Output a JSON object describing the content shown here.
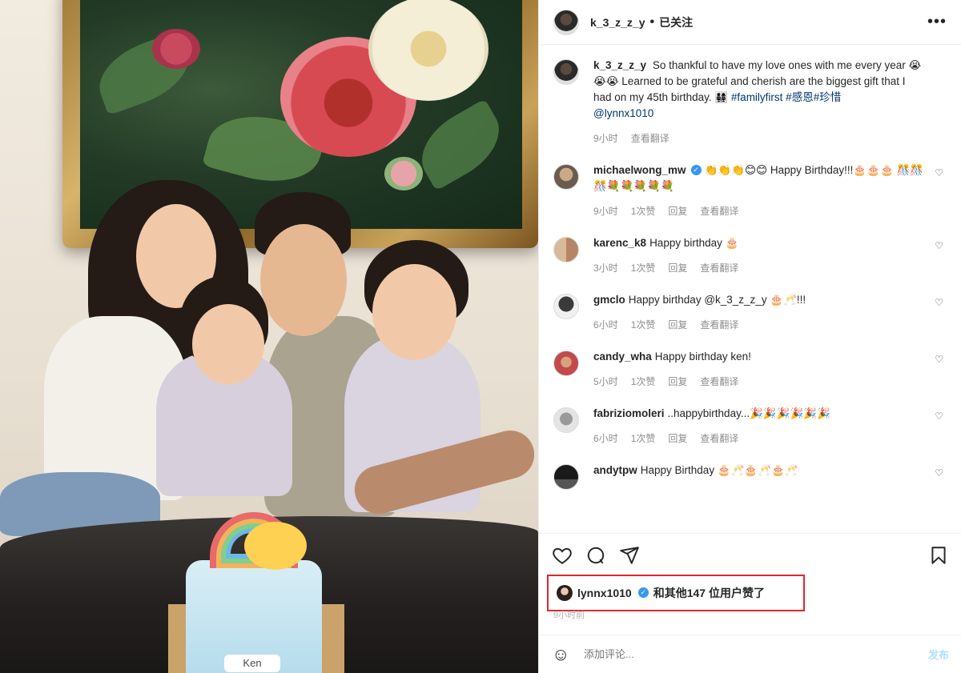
{
  "post": {
    "username": "k_3_z_z_y",
    "separator": "•",
    "follow_status": "已关注",
    "more_icon": "more-icon",
    "caption": {
      "username": "k_3_z_z_y",
      "text": "So thankful to have my love ones with me every year 😭😭😭 Learned to be grateful and cherish are the biggest gift that I had on my 45th birthday. 👨‍👩‍👧‍👧",
      "hashtags": "#familyfirst #感恩#珍惜",
      "mention": "@lynnx1010",
      "time": "9小时",
      "translate": "查看翻译"
    },
    "photo": {
      "cake_name": "Ken"
    }
  },
  "comments": [
    {
      "username": "michaelwong_mw",
      "verified": true,
      "text": "👏👏👏😊😊 Happy Birthday!!!🎂🎂🎂 🎊🎊🎊💐💐💐💐💐",
      "time": "9小时",
      "likes": "1次赞",
      "reply": "回复",
      "translate": "查看翻译"
    },
    {
      "username": "karenc_k8",
      "verified": false,
      "text": "Happy birthday 🎂",
      "time": "3小时",
      "likes": "1次赞",
      "reply": "回复",
      "translate": "查看翻译"
    },
    {
      "username": "gmclo",
      "verified": false,
      "text": "Happy birthday @k_3_z_z_y 🎂🥂!!!",
      "time": "6小时",
      "likes": "1次赞",
      "reply": "回复",
      "translate": "查看翻译"
    },
    {
      "username": "candy_wha",
      "verified": false,
      "text": "Happy birthday ken!",
      "time": "5小时",
      "likes": "1次赞",
      "reply": "回复",
      "translate": "查看翻译"
    },
    {
      "username": "fabriziomoleri",
      "verified": false,
      "text": "..happybirthday...🎉🎉🎉🎉🎉🎉",
      "time": "6小时",
      "likes": "1次赞",
      "reply": "回复",
      "translate": "查看翻译"
    },
    {
      "username": "andytpw",
      "verified": false,
      "text": "Happy Birthday 🎂🥂🎂🥂🎂🥂",
      "time": "",
      "likes": "",
      "reply": "",
      "translate": ""
    }
  ],
  "likes": {
    "first_user": "lynnx1010",
    "rest": "和其他147 位用户赞了",
    "ago": "9小时前"
  },
  "composer": {
    "placeholder": "添加评论...",
    "post_label": "发布"
  },
  "colors": {
    "accent": "#3897f0",
    "highlight_border": "#e0262d",
    "link": "#00376b"
  }
}
